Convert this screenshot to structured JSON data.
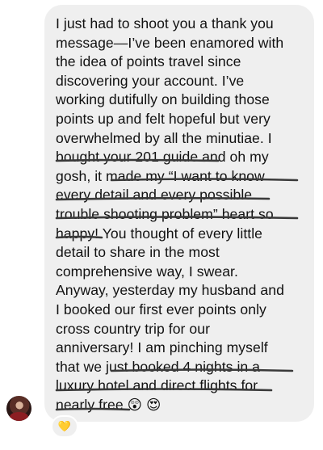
{
  "message": {
    "lines": [
      "I just had to shoot you a thank you",
      "message—I’ve been enamored with",
      "the idea of points travel since",
      "discovering your account. I’ve",
      "working dutifully on building those",
      "points up and felt hopeful but very",
      "overwhelmed by all the minutiae. I",
      "bought your 201 guide and oh my",
      "gosh, it made my “I want to know",
      "every detail and every possible",
      "trouble shooting problem” heart so",
      "happy! You thought of every little",
      "detail to share in the most",
      "comprehensive way, I swear.",
      "Anyway, yesterday my husband and",
      "I booked our first ever points only",
      "cross country trip for our",
      "anniversary! I am pinching myself",
      "that we just booked 4 nights in a",
      "luxury hotel and direct flights for",
      "nearly free"
    ],
    "end_emojis": [
      "😲",
      "😍"
    ]
  },
  "reaction": {
    "emoji": "💛"
  },
  "colors": {
    "bubble": "#efefef",
    "text": "#111111",
    "underline": "#3a3a3a"
  }
}
